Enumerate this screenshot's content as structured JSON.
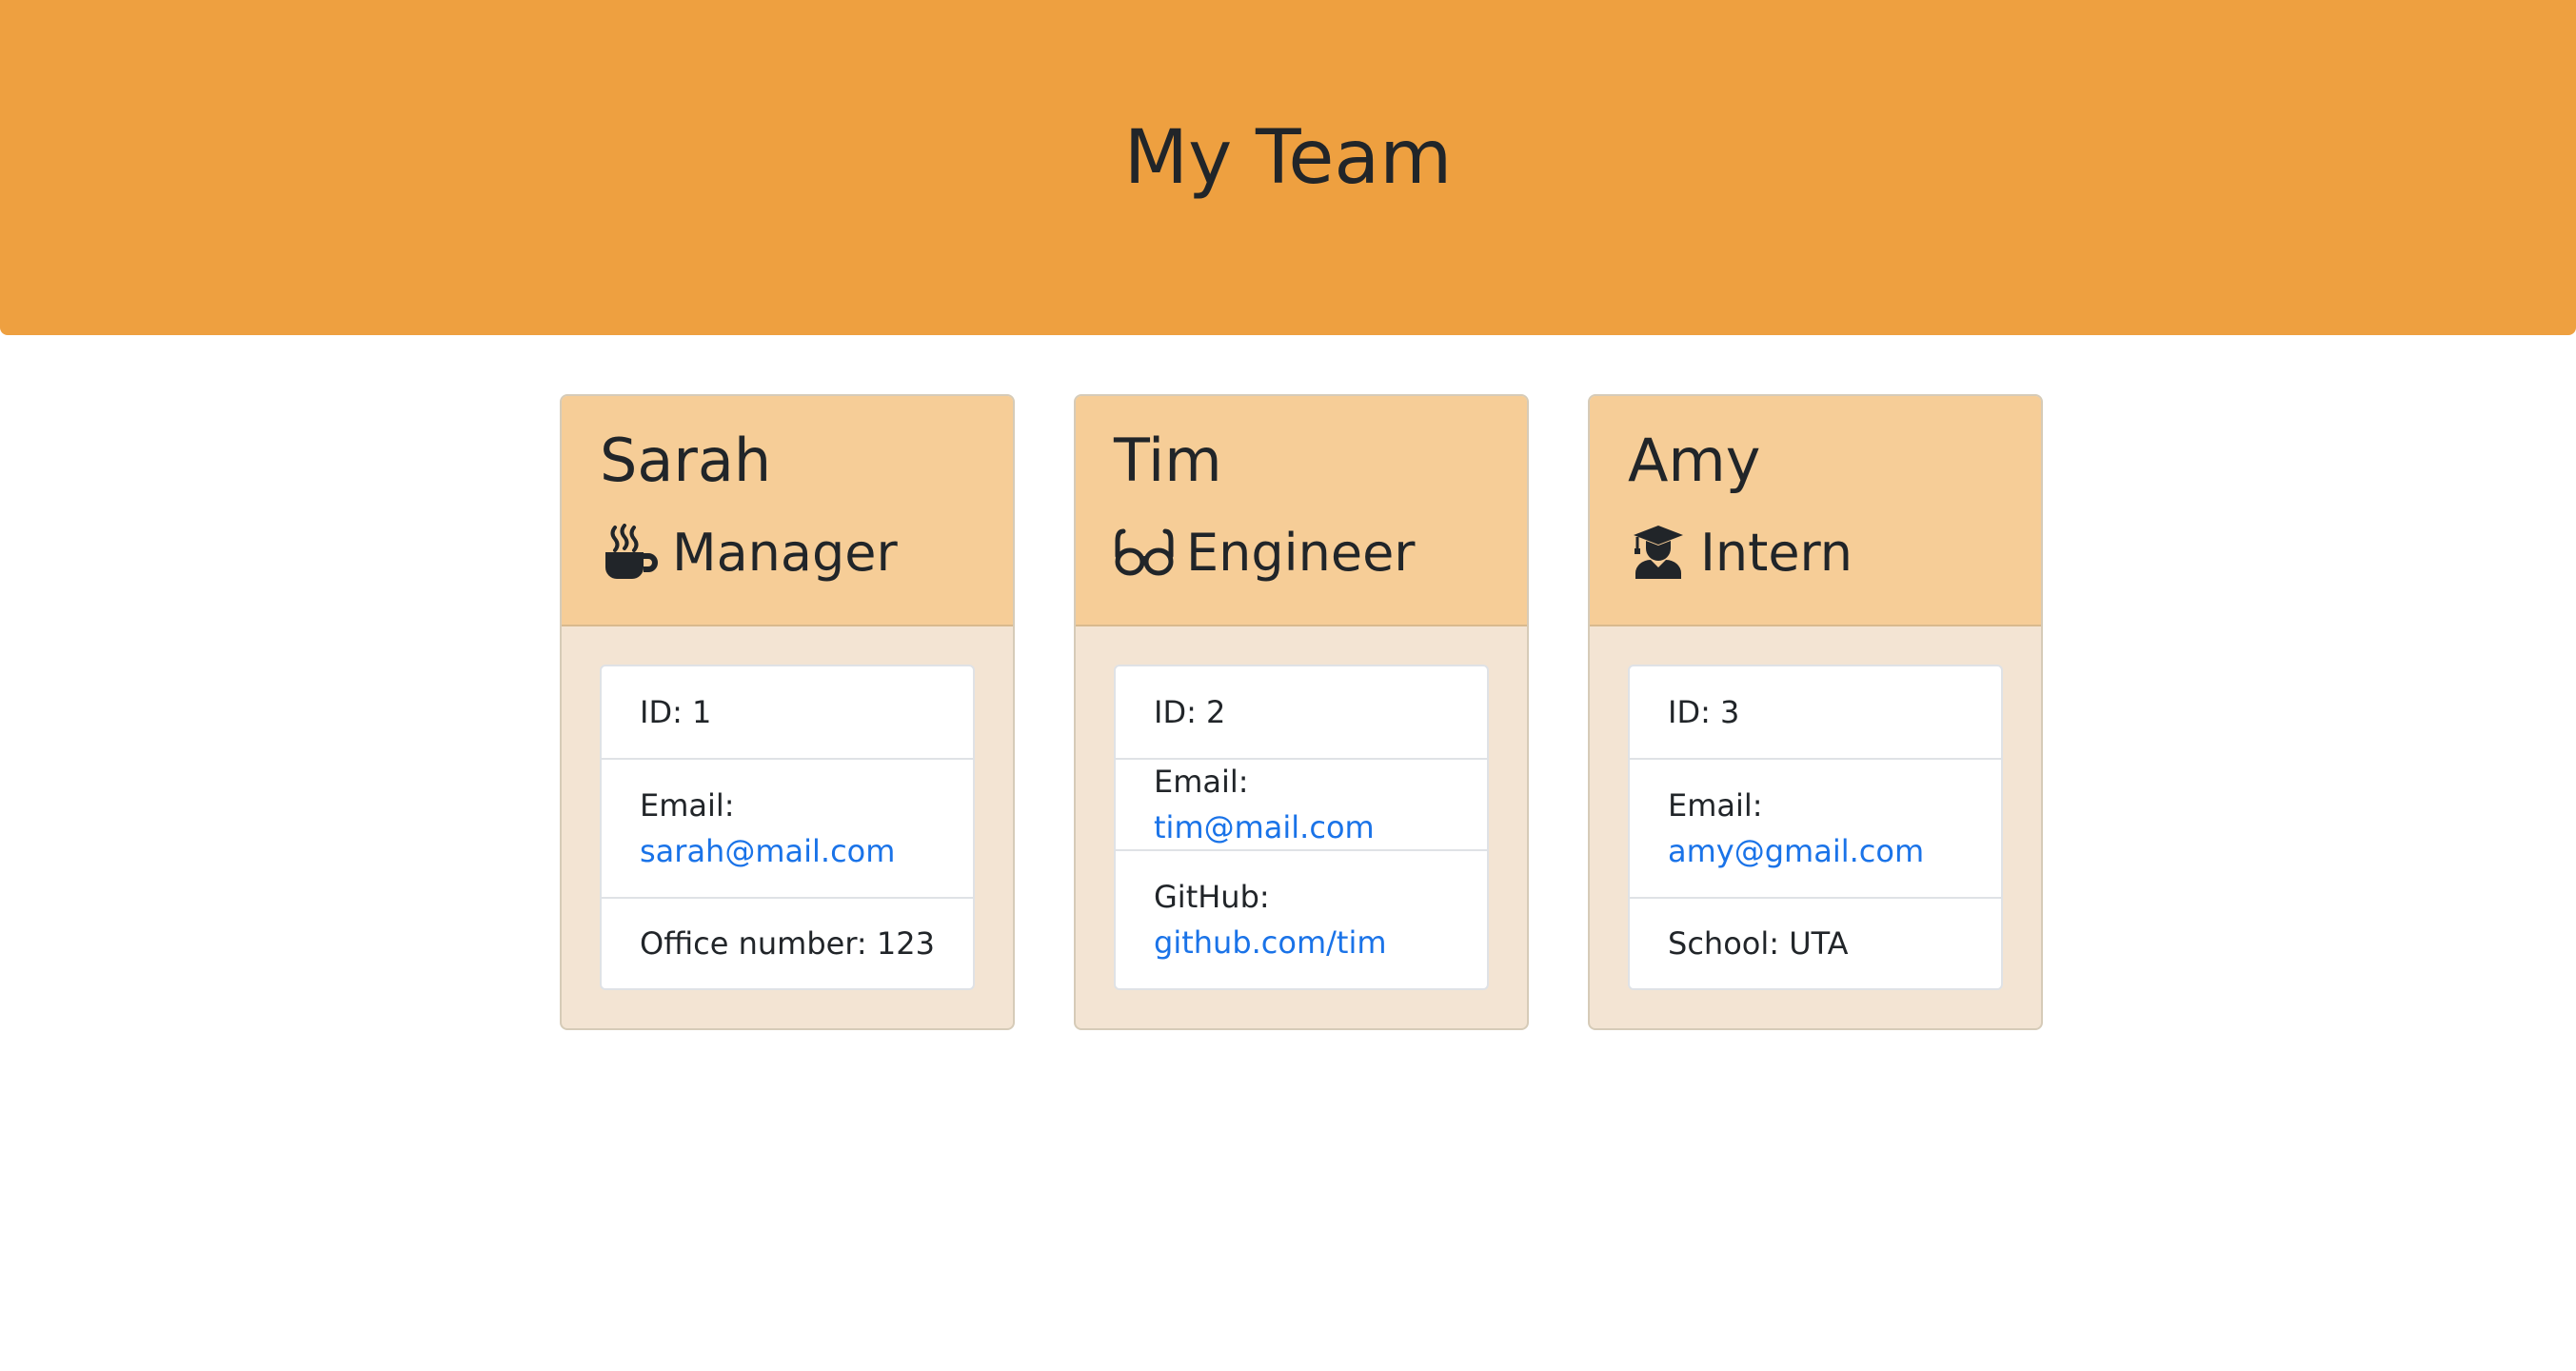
{
  "header": {
    "title": "My Team"
  },
  "colors": {
    "jumbotron": "#eea040",
    "card_header": "#f6cd97",
    "card_body": "#f3e4d3",
    "link": "#1a73e8"
  },
  "cards": [
    {
      "name": "Sarah",
      "role": "Manager",
      "role_icon": "coffee-mug-icon",
      "id_text": "ID: 1",
      "email_label": "Email:",
      "email": "sarah@mail.com",
      "extra_text": "Office number: 123"
    },
    {
      "name": "Tim",
      "role": "Engineer",
      "role_icon": "glasses-icon",
      "id_text": "ID: 2",
      "email_label": "Email:",
      "email": "tim@mail.com",
      "github_label": "GitHub:",
      "github": "github.com/tim"
    },
    {
      "name": "Amy",
      "role": "Intern",
      "role_icon": "graduate-icon",
      "id_text": "ID: 3",
      "email_label": "Email:",
      "email": "amy@gmail.com",
      "extra_text": "School: UTA"
    }
  ]
}
